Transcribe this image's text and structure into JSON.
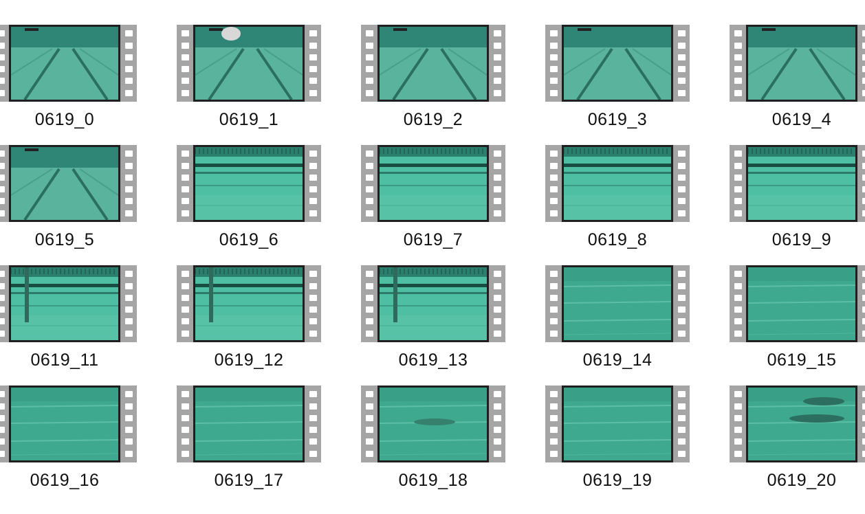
{
  "files": [
    {
      "name": "0619_0",
      "scene": "lane-perspective"
    },
    {
      "name": "0619_1",
      "scene": "lane-perspective"
    },
    {
      "name": "0619_2",
      "scene": "lane-perspective"
    },
    {
      "name": "0619_3",
      "scene": "lane-perspective"
    },
    {
      "name": "0619_4",
      "scene": "lane-perspective"
    },
    {
      "name": "0619_5",
      "scene": "lane-perspective"
    },
    {
      "name": "0619_6",
      "scene": "pool-wall"
    },
    {
      "name": "0619_7",
      "scene": "pool-wall"
    },
    {
      "name": "0619_8",
      "scene": "pool-wall"
    },
    {
      "name": "0619_9",
      "scene": "pool-wall"
    },
    {
      "name": "0619_11",
      "scene": "pool-wall"
    },
    {
      "name": "0619_12",
      "scene": "pool-wall"
    },
    {
      "name": "0619_13",
      "scene": "pool-wall"
    },
    {
      "name": "0619_14",
      "scene": "pool-floor"
    },
    {
      "name": "0619_15",
      "scene": "pool-floor"
    },
    {
      "name": "0619_16",
      "scene": "pool-floor"
    },
    {
      "name": "0619_17",
      "scene": "pool-floor"
    },
    {
      "name": "0619_18",
      "scene": "pool-floor"
    },
    {
      "name": "0619_19",
      "scene": "pool-floor"
    },
    {
      "name": "0619_20",
      "scene": "pool-floor"
    }
  ],
  "colors": {
    "film_strip": "#a5a5a5",
    "frame_border": "#1f1f1f",
    "water_light": "#4fbfa3",
    "water_dark": "#2f8f7a",
    "label_text": "#111111"
  }
}
